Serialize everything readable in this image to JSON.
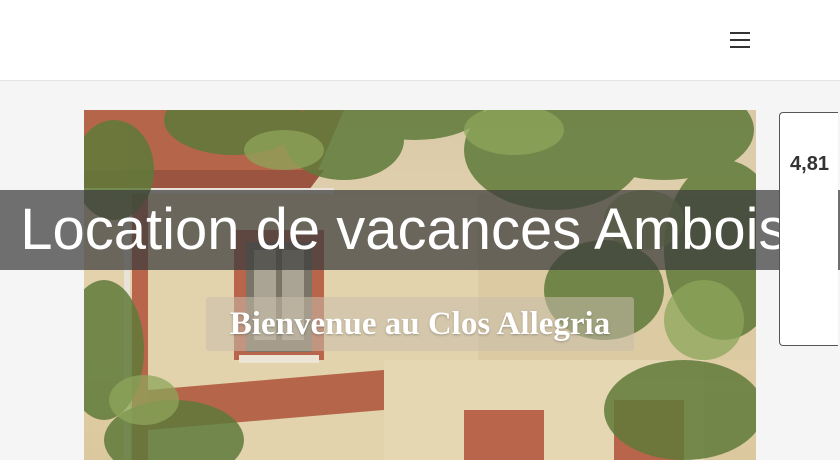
{
  "header": {
    "menu_icon": "hamburger-menu-icon"
  },
  "hero": {
    "title": "Location de vacances Amboise",
    "subtitle": "Bienvenue au Clos Allegria",
    "image": "house-facade-with-foliage"
  },
  "rating": {
    "score": "4,81"
  },
  "colors": {
    "header_bg": "#ffffff",
    "page_bg": "#f5f5f5",
    "title_band": "#3c3c3c",
    "text_light": "#ffffff"
  }
}
